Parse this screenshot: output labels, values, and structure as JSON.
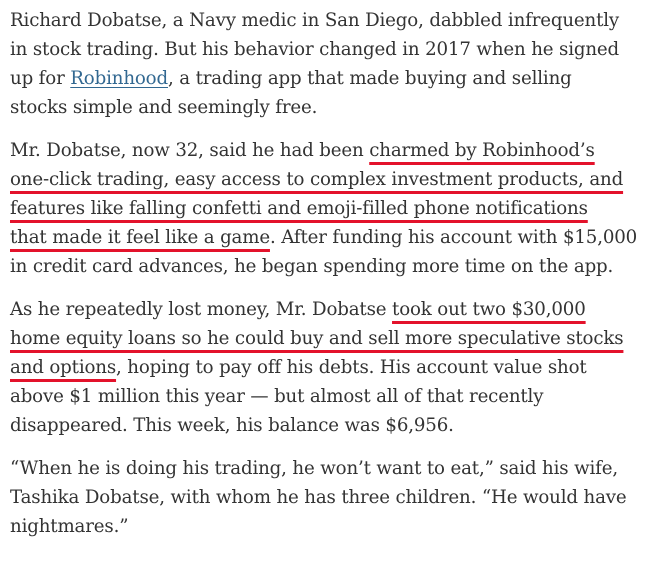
{
  "article": {
    "p1": {
      "l1": "Richard Dobatse, a Navy medic in San Diego, dabbled infrequently",
      "l2": "in stock trading. But his behavior changed in 2017 when he signed",
      "l3_pre": "up for ",
      "l3_link": "Robinhood",
      "l3_post": ", a trading app that made buying and selling",
      "l4": "stocks simple and seemingly free."
    },
    "p2": {
      "l1_pre": "Mr. Dobatse, now 32, said he had been ",
      "l1_hl": "charmed by Robinhood’s",
      "l2_hl": "one-click trading, easy access to complex investment products, and",
      "l3_hl": "features like falling confetti and emoji-filled phone notifications",
      "l4_hl": "that made it feel like a game",
      "l4_post": ". After funding his account with $15,000",
      "l5": "in credit card advances, he began spending more time on the app."
    },
    "p3": {
      "l1_pre": "As he repeatedly lost money, Mr. Dobatse ",
      "l1_hl": "took out two $30,000",
      "l2_hl": "home equity loans so he could buy and sell more speculative stocks",
      "l3_hl": "and options",
      "l3_post": ", hoping to pay off his debts. His account value shot",
      "l4": "above $1 million this year — but almost all of that recently",
      "l5": "disappeared. This week, his balance was $6,956."
    },
    "p4": {
      "l1": "“When he is doing his trading, he won’t want to eat,” said his wife,",
      "l2": "Tashika Dobatse, with whom he has three children. “He would have",
      "l3": "nightmares.”"
    }
  },
  "colors": {
    "text": "#333333",
    "link": "#326891",
    "highlight_underline": "#e3122b"
  }
}
